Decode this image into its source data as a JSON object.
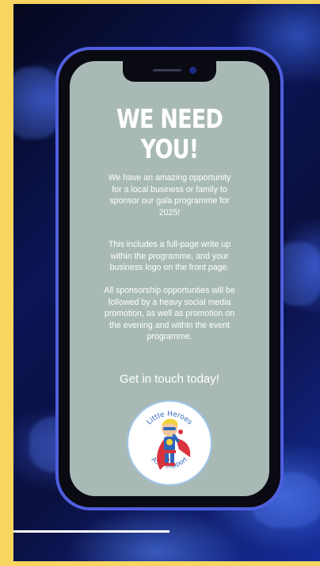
{
  "headline": [
    "WE NEED",
    "YOU!"
  ],
  "paragraphs": [
    [
      "We have an amazing opportunity",
      "for a local business or family to",
      "sponsor our gala programme for",
      "2025!"
    ],
    [
      "This includes a full-page write up",
      "within the programme, and your",
      "business logo on the front page."
    ],
    [
      "All sponsorship opportunties will be",
      "followed by a heavy social media",
      "promotion, as well as promotion on",
      "the evening and within the event",
      "programme."
    ]
  ],
  "cta": "Get in touch today!",
  "logo": {
    "top_text": "Little Heroes",
    "bottom_text": "ASD Support",
    "icon": "superhero-icon"
  },
  "colors": {
    "outer_border": "#f7d560",
    "phone_frame": "#4f5fe0",
    "screen": "#a9bab6",
    "text": "#ffffff"
  }
}
